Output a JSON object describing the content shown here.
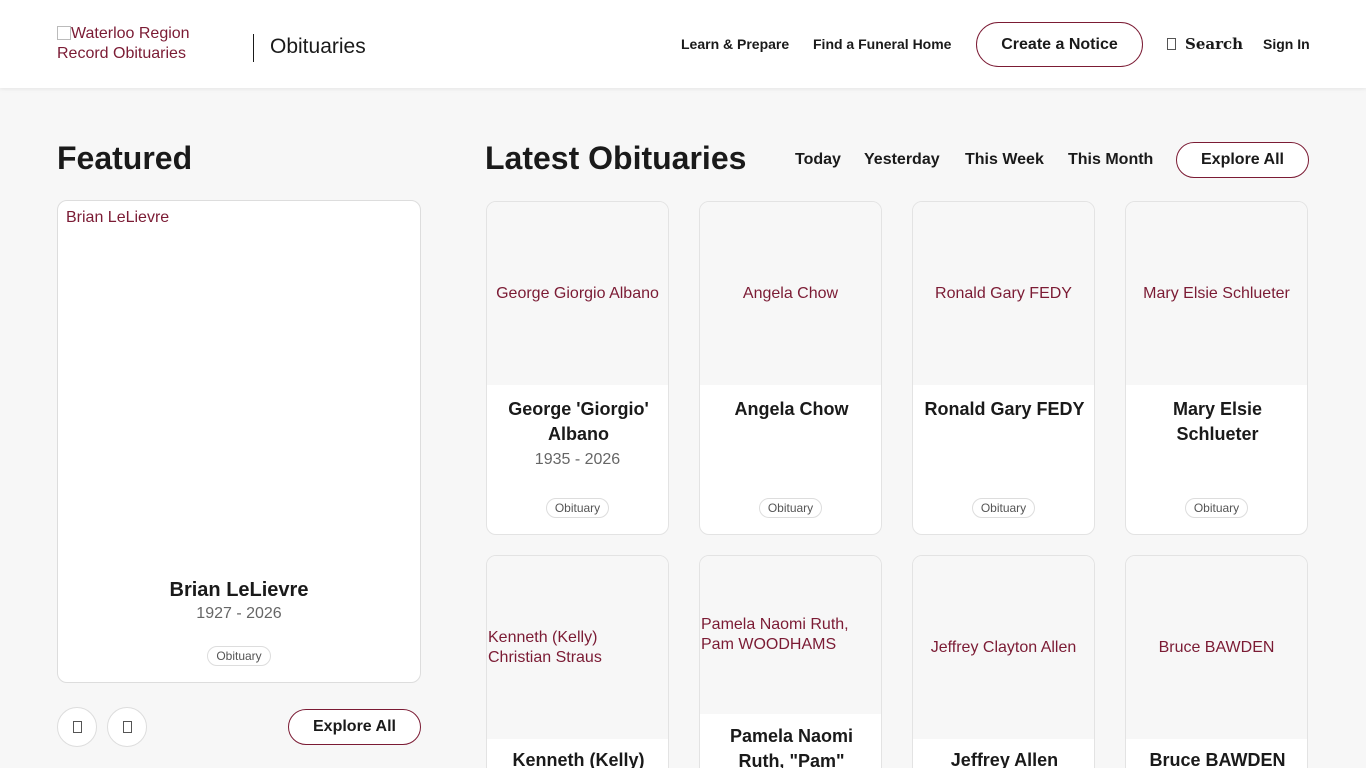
{
  "header": {
    "logo_alt": "Waterloo Region Record Obituaries",
    "section_title": "Obituaries",
    "nav": {
      "learn": "Learn & Prepare",
      "funeral": "Find a Funeral Home",
      "create": "Create a Notice",
      "search": "Search",
      "signin": "Sign In"
    },
    "search_icon": "search-icon"
  },
  "featured": {
    "heading": "Featured",
    "card": {
      "img_alt": "Brian LeLievre",
      "name": "Brian LeLievre",
      "years": "1927 - 2026",
      "tag": "Obituary"
    },
    "prev_icon": "chevron-left-icon",
    "next_icon": "chevron-right-icon",
    "explore": "Explore All"
  },
  "latest": {
    "heading": "Latest Obituaries",
    "filters": [
      "Today",
      "Yesterday",
      "This Week",
      "This Month"
    ],
    "explore": "Explore All",
    "cards": [
      {
        "img_alt": "George Giorgio Albano",
        "name": "George 'Giorgio' Albano",
        "years": "1935 - 2026",
        "tag": "Obituary"
      },
      {
        "img_alt": "Angela Chow",
        "name": "Angela Chow",
        "years": "",
        "tag": "Obituary"
      },
      {
        "img_alt": "Ronald Gary FEDY",
        "name": "Ronald Gary FEDY",
        "years": "",
        "tag": "Obituary"
      },
      {
        "img_alt": "Mary Elsie Schlueter",
        "name": "Mary Elsie Schlueter",
        "years": "",
        "tag": "Obituary"
      },
      {
        "img_alt": "Kenneth (Kelly) Christian Straus",
        "name": "Kenneth (Kelly)",
        "years": "",
        "tag": ""
      },
      {
        "img_alt": "Pamela Naomi Ruth, Pam WOODHAMS",
        "name": "Pamela Naomi Ruth, \"Pam\"",
        "years": "",
        "tag": ""
      },
      {
        "img_alt": "Jeffrey Clayton Allen",
        "name": "Jeffrey Allen",
        "years": "",
        "tag": ""
      },
      {
        "img_alt": "Bruce BAWDEN",
        "name": "Bruce BAWDEN",
        "years": "",
        "tag": ""
      }
    ]
  }
}
